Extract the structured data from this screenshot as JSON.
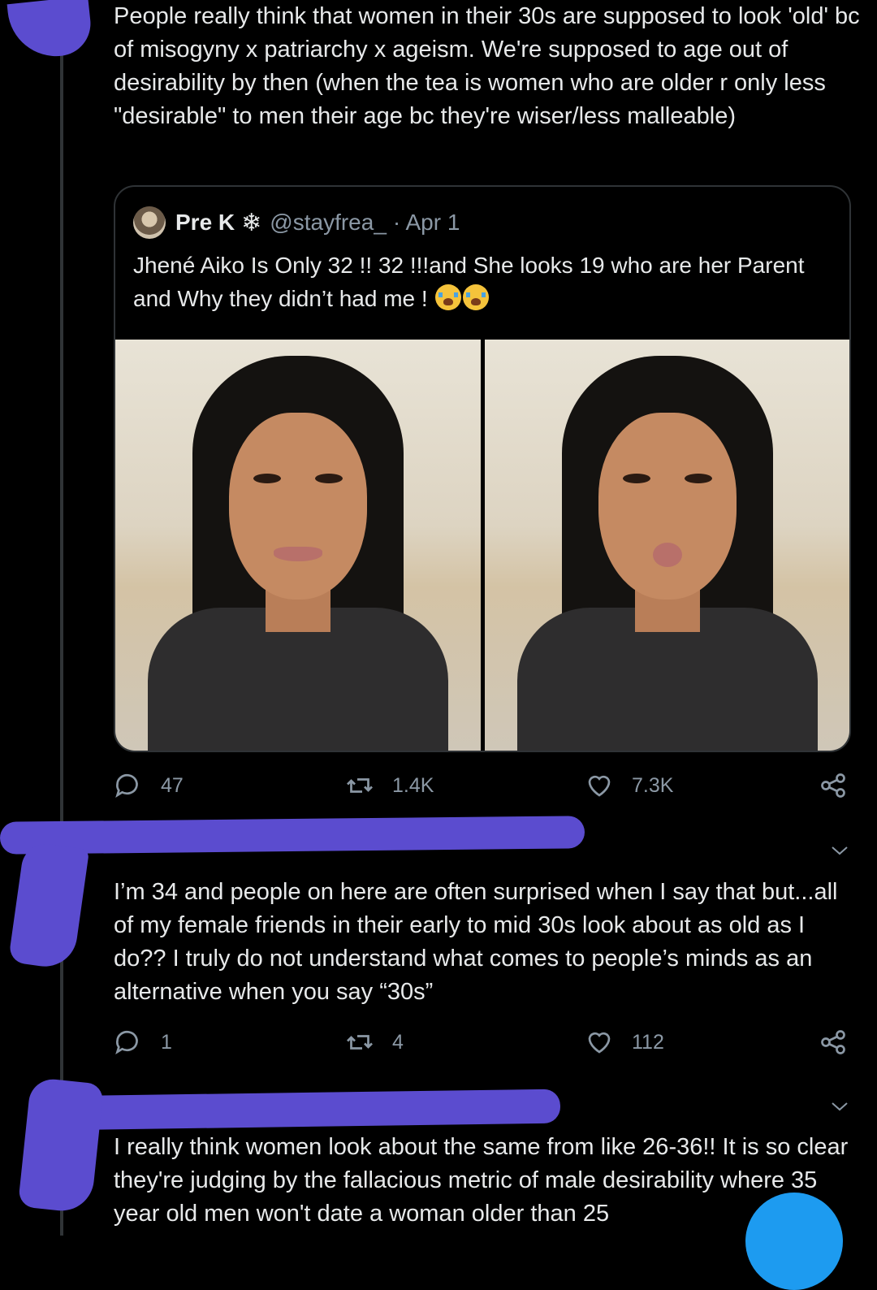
{
  "main_tweet": {
    "text": "People really think that women in their 30s are supposed to look 'old' bc of misogyny x patriarchy x ageism. We're supposed to age out of desirability by then (when the tea is women who are older r only less \"desirable\" to men their age bc they're wiser/less malleable)"
  },
  "quoted_tweet": {
    "name": "Pre K",
    "badge_icon": "snowflake-icon",
    "handle": "@stayfrea_",
    "date": "· Apr 1",
    "text": "Jhené Aiko Is Only 32 !! 32 !!!and She looks 19 who are her Parent and Why they didn’t had me !",
    "emoji": "loudly-crying-face"
  },
  "main_actions": {
    "replies": "47",
    "retweets": "1.4K",
    "likes": "7.3K"
  },
  "reply_1": {
    "text": "I’m 34 and people on here are often surprised when I say that but...all of my female friends in their early to mid 30s look about as old as I do?? I truly do not understand what comes to people’s minds as an alternative when you say “30s”",
    "actions": {
      "replies": "1",
      "retweets": "4",
      "likes": "112"
    }
  },
  "reply_2": {
    "text": "I really think women look about the same from like 26-36!! It is so clear they're judging by the fallacious metric of male desirability where 35 year old men won't date a woman older than 25"
  },
  "colors": {
    "background": "#000000",
    "text": "#e7e9ea",
    "muted": "#8b98a5",
    "redaction": "#5b4ccf",
    "accent": "#1d9bf0"
  }
}
